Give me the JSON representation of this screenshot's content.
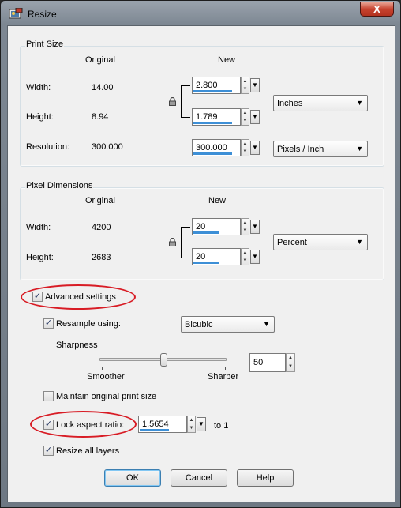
{
  "window": {
    "title": "Resize",
    "close_label": "X"
  },
  "print_size": {
    "group_title": "Print Size",
    "col_original": "Original",
    "col_new": "New",
    "width_label": "Width:",
    "width_original": "14.00",
    "width_new": "2.800",
    "width_progress": 0.82,
    "height_label": "Height:",
    "height_original": "8.94",
    "height_new": "1.789",
    "height_progress": 0.82,
    "unit": "Inches",
    "resolution_label": "Resolution:",
    "resolution_original": "300.000",
    "resolution_new": "300.000",
    "resolution_progress": 0.82,
    "resolution_unit": "Pixels / Inch"
  },
  "pixel_dimensions": {
    "group_title": "Pixel Dimensions",
    "col_original": "Original",
    "col_new": "New",
    "width_label": "Width:",
    "width_original": "4200",
    "width_new": "20",
    "width_progress": 0.55,
    "height_label": "Height:",
    "height_original": "2683",
    "height_new": "20",
    "height_progress": 0.55,
    "unit": "Percent"
  },
  "advanced": {
    "label": "Advanced settings",
    "checked": true,
    "resample_label": "Resample using:",
    "resample_checked": true,
    "resample_method": "Bicubic",
    "sharpness_label": "Sharpness",
    "sharpness_value": "50",
    "sharpness_level": 0.5,
    "smoother_label": "Smoother",
    "sharper_label": "Sharper",
    "maintain_label": "Maintain original print size",
    "maintain_checked": false,
    "lock_label": "Lock aspect ratio:",
    "lock_checked": true,
    "ratio_value": "1.5654",
    "ratio_progress": 0.62,
    "ratio_suffix": "to 1",
    "resize_layers_label": "Resize all layers",
    "resize_layers_checked": true
  },
  "buttons": {
    "ok": "OK",
    "cancel": "Cancel",
    "help": "Help"
  },
  "colors": {
    "highlight_oval": "#d81c25",
    "progress_bar": "#3d8fd6"
  },
  "icons": [
    "app-icon",
    "lock-icon",
    "chevron-down-icon",
    "check-icon",
    "spin-arrow-icon"
  ]
}
